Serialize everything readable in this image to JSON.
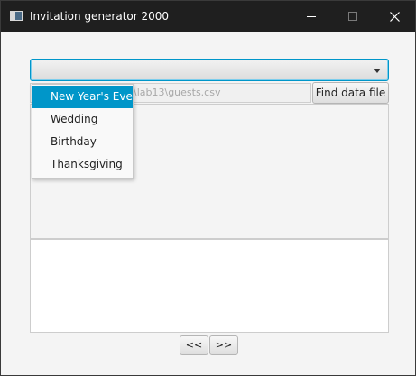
{
  "window": {
    "title": "Invitation generator 2000",
    "controls": {
      "minimize_icon": "minimize-icon",
      "maximize_icon": "maximize-icon",
      "close_icon": "close-icon"
    }
  },
  "event_combo": {
    "selected_value": "",
    "options": [
      "New Year's Eve",
      "Wedding",
      "Birthday",
      "Thanksgiving"
    ],
    "highlighted_option": "New Year's Eve"
  },
  "data_file": {
    "path_text": "\\lab13\\guests.csv",
    "find_button_label": "Find data file"
  },
  "navigation": {
    "prev_label": "<<",
    "next_label": ">>"
  },
  "colors": {
    "accent": "#0096c9",
    "titlebar": "#1f1f1f",
    "window_bg": "#f4f4f4"
  }
}
